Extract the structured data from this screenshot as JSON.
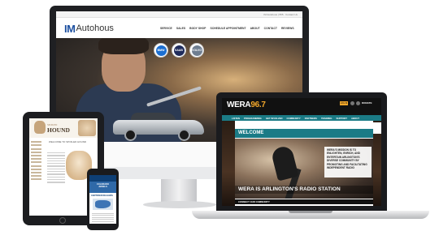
{
  "desktop": {
    "site_name_prefix": "IM",
    "site_name_suffix": "Autohous",
    "top_contact": "IM Autohous | 555 · Contact Us",
    "nav": [
      "SERVICE",
      "SALES",
      "BODY SHOP",
      "SCHEDULE APPOINTMENT",
      "ABOUT",
      "CONTACT",
      "REVIEWS"
    ],
    "brands": [
      {
        "name": "bmw",
        "label": "BMW",
        "color": "#1c6fd1"
      },
      {
        "name": "saab",
        "label": "SAAB",
        "color": "#1f2c5c"
      },
      {
        "name": "volvo",
        "label": "VOLVO",
        "color": "#6f7e91"
      }
    ]
  },
  "laptop": {
    "logo_text": "WERA",
    "logo_num": "96.7",
    "login_label": "LOG IN",
    "donate_label": "DONATE",
    "nav": [
      "LISTEN",
      "PROGRAMMING",
      "GET INVOLVED",
      "COMMUNITY",
      "PARTNERS",
      "TRAINING",
      "SUPPORT",
      "ABOUT"
    ],
    "welcome": "WELCOME",
    "mission": "WERA'S MISSION IS TO ENLIGHTEN, ENRICH, AND ENTERTAIN ARLINGTON'S DIVERSE COMMUNITY BY PROMOTING AND FACILITATING INDEPENDENT RADIO",
    "caption": "WERA IS ARLINGTON'S RADIO STATION",
    "connect": "CONNECT OUR COMMUNITY"
  },
  "tablet": {
    "site_name": "HOUND",
    "site_prefix": "SPOILED",
    "welcome": "WELCOME TO SPOILED HOUND"
  },
  "phone": {
    "banner_line1": "COLORADO",
    "banner_line2": "JEWELS",
    "subtitle": "CERTIFIED DEALERS"
  }
}
